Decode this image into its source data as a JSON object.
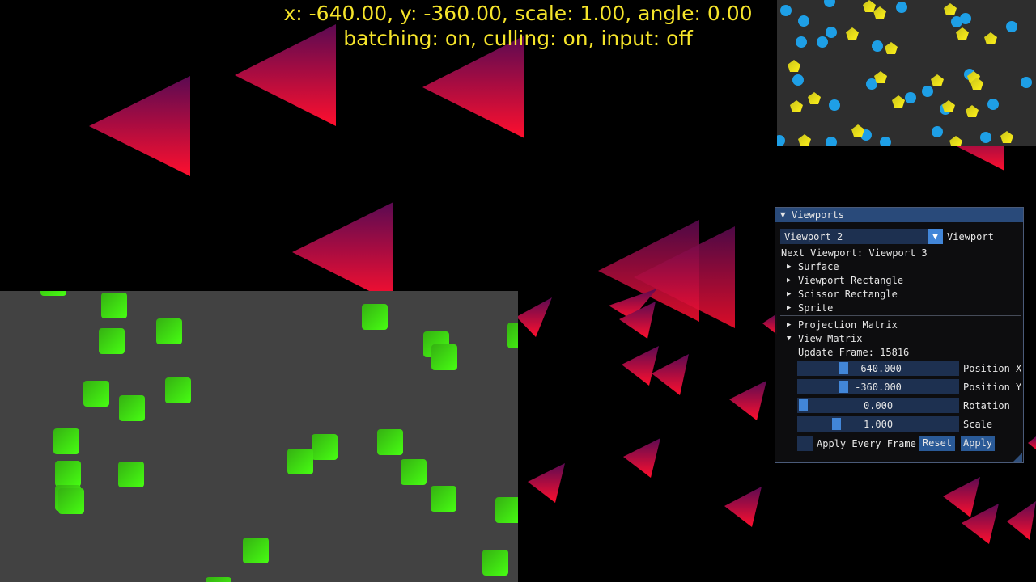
{
  "hud": {
    "line1": "x: -640.00, y: -360.00, scale: 1.00, angle: 0.00",
    "line2": "batching: on, culling: on, input: off"
  },
  "colors": {
    "hud_text": "#f5e42a",
    "triangle_dark": "#5a0a52",
    "triangle_bright": "#ff0f2e",
    "green_viewport_bg": "#424242",
    "green_square": "#3ce010",
    "top_viewport_bg": "#2e2e2e",
    "circle": "#1e9fe6",
    "pentagon": "#f0e21a",
    "window_title": "#294a7a",
    "frame_bg": "#1d3050",
    "accent": "#4286d8"
  },
  "window": {
    "title": "Viewports",
    "combo": {
      "value": "Viewport 2",
      "label": "Viewport"
    },
    "next_viewport": "Next Viewport: Viewport 3",
    "tree": [
      "Surface",
      "Viewport Rectangle",
      "Scissor Rectangle",
      "Sprite"
    ],
    "tree2": [
      "Projection Matrix",
      "View Matrix"
    ],
    "update_frame": "Update Frame: 15816",
    "sliders": [
      {
        "value": "-640.000",
        "label": "Position X",
        "fraction": 0.27
      },
      {
        "value": "-360.000",
        "label": "Position Y",
        "fraction": 0.27
      },
      {
        "value": "0.000",
        "label": "Rotation",
        "fraction": 0.0
      },
      {
        "value": "1.000",
        "label": "Scale",
        "fraction": 0.22
      }
    ],
    "checkbox_label": "Apply Every Frame",
    "checkbox_checked": false,
    "reset_label": "Reset",
    "apply_label": "Apply"
  }
}
